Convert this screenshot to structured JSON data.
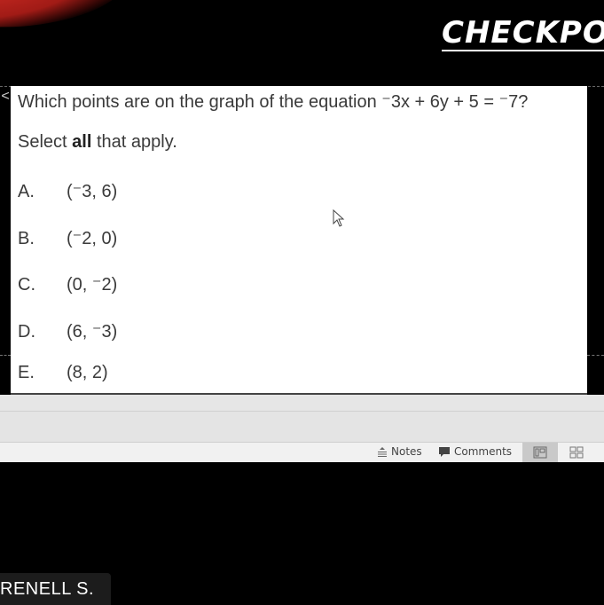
{
  "slide": {
    "title": "CHECKPO",
    "accent_color": "#c0261f"
  },
  "question": {
    "text_prefix": "Which points are on the graph of the equation ",
    "equation": "⁻3x + 6y + 5 = ⁻7?",
    "instruction_prefix": "Select ",
    "instruction_bold": "all",
    "instruction_suffix": " that apply.",
    "options": [
      {
        "letter": "A.",
        "value": "(⁻3, 6)"
      },
      {
        "letter": "B.",
        "value": "(⁻2, 0)"
      },
      {
        "letter": "C.",
        "value": "(0, ⁻2)"
      },
      {
        "letter": "D.",
        "value": "(6, ⁻3)"
      },
      {
        "letter": "E.",
        "value": "(8, 2)"
      }
    ]
  },
  "nav": {
    "back_glyph": "<"
  },
  "status_bar": {
    "notes_label": "Notes",
    "comments_label": "Comments",
    "notes_icon": "notes-icon",
    "comments_icon": "comment-bubble-icon",
    "normal_view_icon": "normal-view-icon",
    "slide_sorter_icon": "slide-sorter-icon"
  },
  "participant": {
    "name": "RENELL S."
  }
}
